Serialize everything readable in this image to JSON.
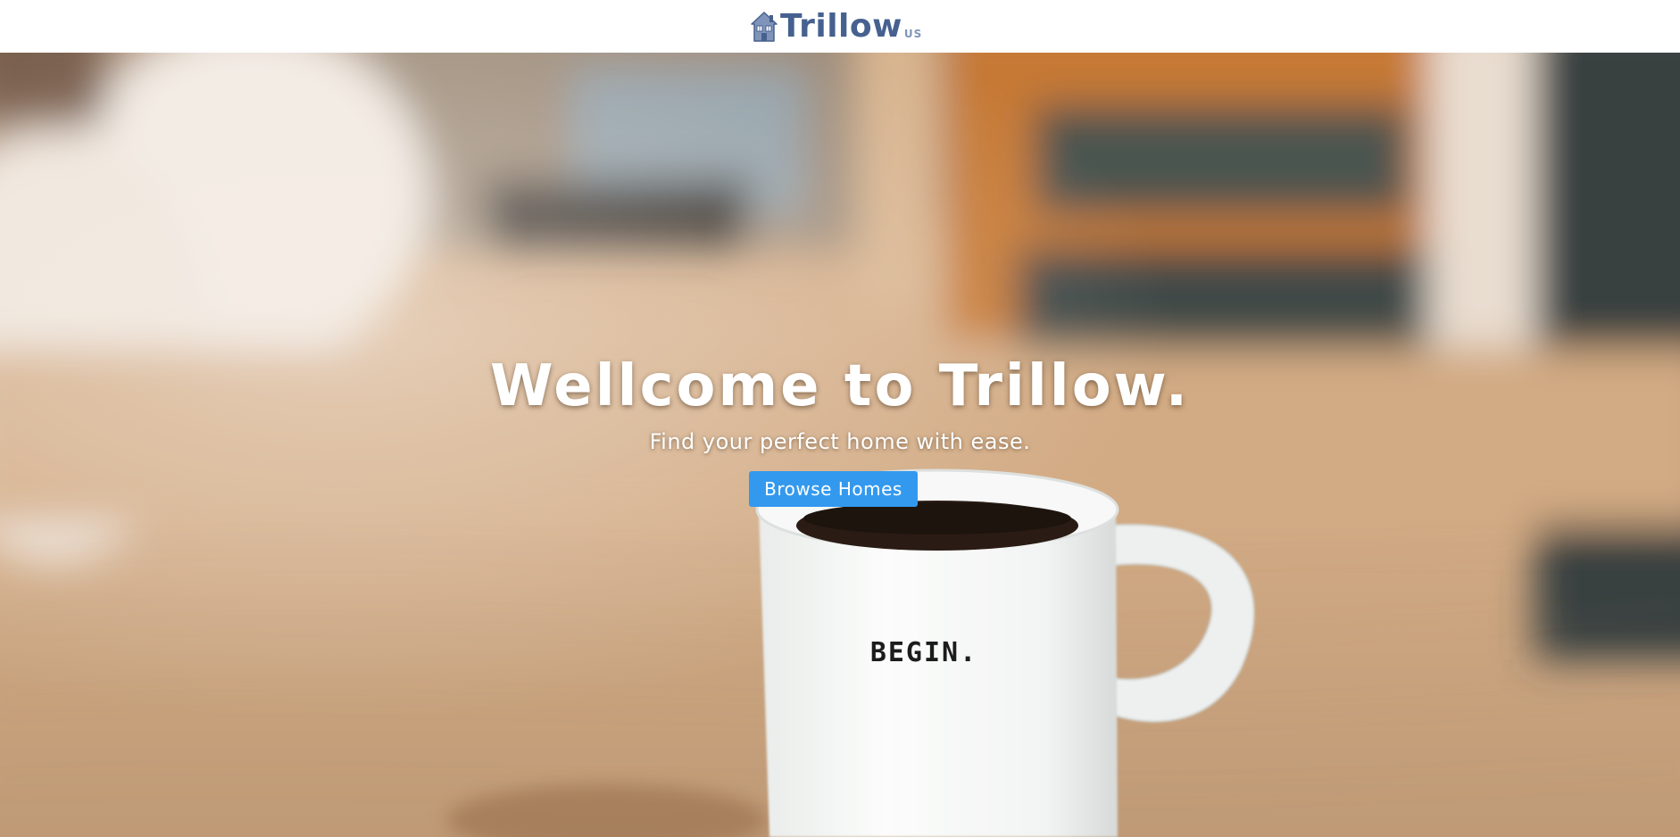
{
  "header": {
    "logo_text": "Trillow",
    "logo_sub": "US"
  },
  "hero": {
    "title": "Wellcome to Trillow.",
    "subtitle": "Find your perfect home with ease.",
    "cta_label": "Browse Homes",
    "mug_text": "BEGIN."
  },
  "colors": {
    "brand": "#46618f",
    "brand_light": "#7f94b8",
    "cta_background": "#3399ee",
    "hero_text": "#ffffff"
  }
}
